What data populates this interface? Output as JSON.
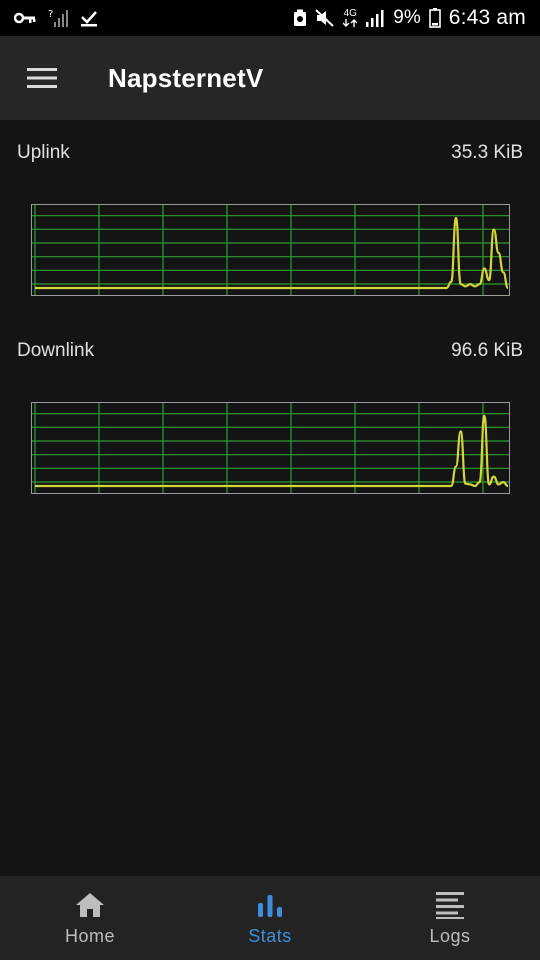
{
  "status_bar": {
    "battery_percent": "9%",
    "time": "6:43 am",
    "network_type": "4G",
    "icons": [
      "key-icon",
      "signal-unknown-icon",
      "check-icon",
      "vpn-icon",
      "mute-icon",
      "network-4g-icon",
      "signal-icon",
      "battery-icon"
    ]
  },
  "app_bar": {
    "title": "NapsternetV",
    "menu_icon": "hamburger-menu-icon"
  },
  "stats": {
    "uplink": {
      "label": "Uplink",
      "value": "35.3 KiB"
    },
    "downlink": {
      "label": "Downlink",
      "value": "96.6 KiB"
    }
  },
  "chart_data": [
    {
      "type": "line",
      "name": "uplink",
      "xlim": [
        0,
        100
      ],
      "ylim": [
        0,
        100
      ],
      "grid": true,
      "x": [
        0,
        87,
        88,
        89,
        90,
        91,
        92,
        93,
        94,
        95,
        96,
        97,
        98,
        99,
        100
      ],
      "values": [
        0,
        0,
        8,
        90,
        5,
        2,
        5,
        2,
        5,
        25,
        10,
        75,
        45,
        20,
        0
      ]
    },
    {
      "type": "line",
      "name": "downlink",
      "xlim": [
        0,
        100
      ],
      "ylim": [
        0,
        100
      ],
      "grid": true,
      "x": [
        0,
        88,
        89,
        90,
        91,
        92,
        93,
        94,
        95,
        96,
        97,
        98,
        99,
        100
      ],
      "values": [
        0,
        0,
        25,
        70,
        3,
        2,
        0,
        5,
        90,
        2,
        12,
        2,
        5,
        0
      ]
    }
  ],
  "colors": {
    "background": "#141414",
    "app_bar": "#262626",
    "grid": "#2e9e2e",
    "line": "#d4d43c",
    "active": "#3f8edb",
    "inactive": "#bdbdbd"
  },
  "bottom_nav": {
    "items": [
      {
        "label": "Home",
        "icon": "home-icon",
        "active": false
      },
      {
        "label": "Stats",
        "icon": "bar-chart-icon",
        "active": true
      },
      {
        "label": "Logs",
        "icon": "list-icon",
        "active": false
      }
    ]
  }
}
